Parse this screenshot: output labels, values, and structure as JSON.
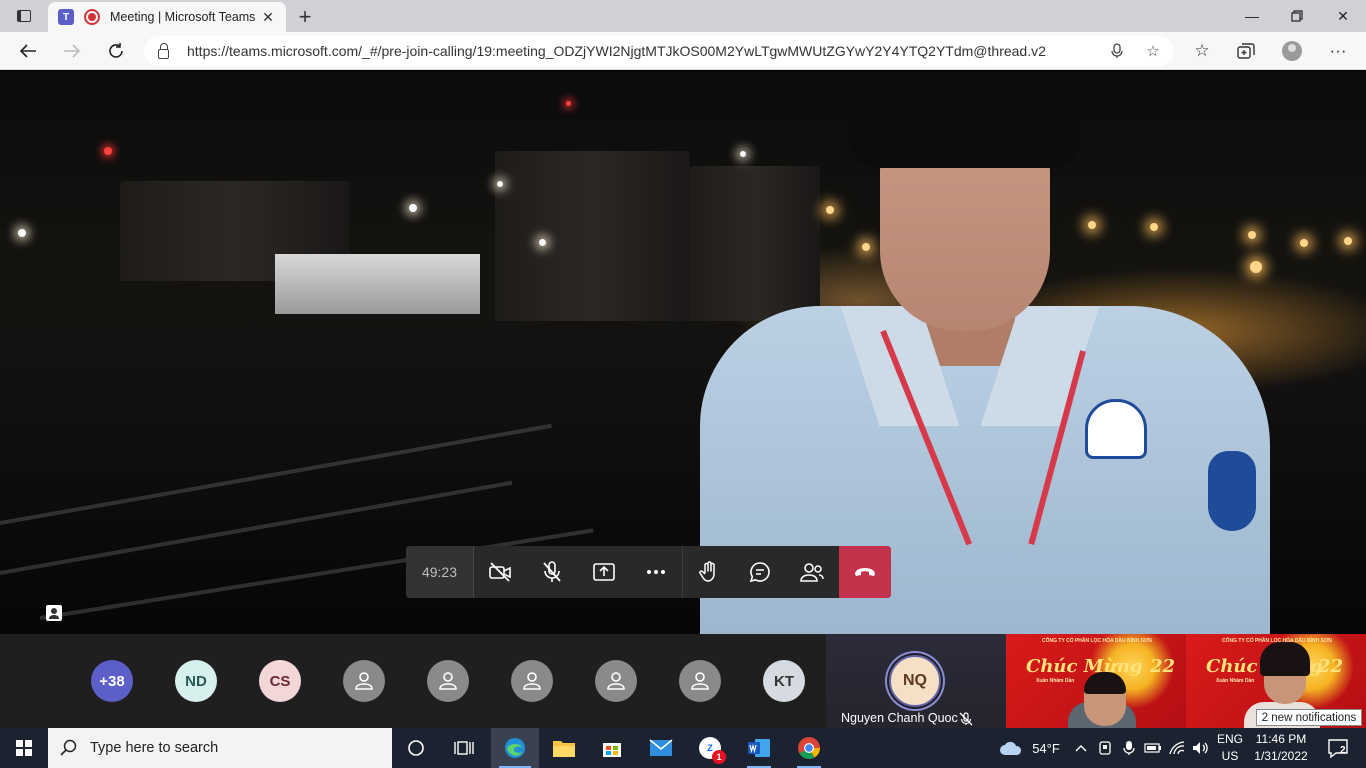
{
  "browser": {
    "tab_title": "Meeting | Microsoft Teams",
    "url": "https://teams.microsoft.com/_#/pre-join-calling/19:meeting_ODZjYWI2NjgtMTJkOS00M2YwLTgwMWUtZGYwY2Y4YTQ2YTdm@thread.v2",
    "teams_glyph": "T",
    "icons": [
      "tab-actions-icon",
      "teams-favicon-icon",
      "recording-icon",
      "close-icon",
      "new-tab-icon",
      "minimize-icon",
      "maximize-icon",
      "window-close-icon",
      "back-icon",
      "forward-icon",
      "refresh-icon",
      "lock-icon",
      "microphone-icon",
      "add-favorite-icon",
      "favorites-icon",
      "collections-icon",
      "profile-icon",
      "more-icon"
    ]
  },
  "meeting": {
    "timer": "49:23",
    "controls": [
      "camera-off-icon",
      "mic-off-icon",
      "share-screen-icon",
      "more-actions-icon",
      "raise-hand-icon",
      "chat-icon",
      "participants-icon",
      "hang-up-icon"
    ],
    "accent_color": "#6264a7",
    "hangup_color": "#c4314b"
  },
  "participants": {
    "overflow": "+38",
    "avatars": [
      {
        "initials": "ND"
      },
      {
        "initials": "CS"
      },
      {
        "initials": ""
      },
      {
        "initials": ""
      },
      {
        "initials": ""
      },
      {
        "initials": ""
      },
      {
        "initials": ""
      },
      {
        "initials": "KT"
      }
    ],
    "active_speaker": {
      "initials": "NQ",
      "name": "Nguyen Chanh Quoc",
      "muted": true
    }
  },
  "video_tiles": {
    "banner_text": "CÔNG TY CỔ PHẦN LỌC HÓA DẦU BÌNH SƠN",
    "greeting": "Chúc Mừng",
    "year_suffix": "22",
    "subtitle": "Xuân Nhâm Dần"
  },
  "notification_toast": "2 new notifications",
  "taskbar": {
    "search_placeholder": "Type here to search",
    "weather": "54°F",
    "lang_line1": "ENG",
    "lang_line2": "US",
    "time": "11:46 PM",
    "date": "1/31/2022",
    "notification_count": "2",
    "mail_badge": "1"
  }
}
